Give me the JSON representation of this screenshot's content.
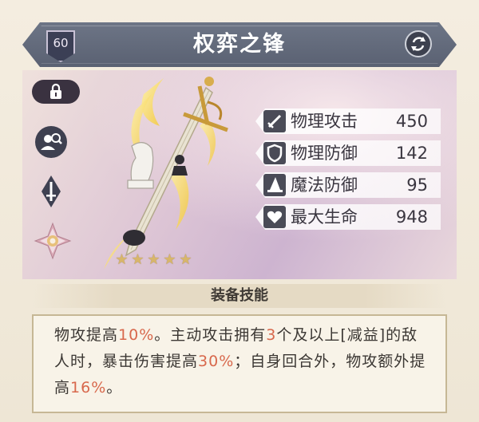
{
  "header": {
    "level": "60",
    "title": "权弈之锋"
  },
  "stats": [
    {
      "icon": "sword-icon",
      "label": "物理攻击",
      "value": "450"
    },
    {
      "icon": "shield-icon",
      "label": "物理防御",
      "value": "142"
    },
    {
      "icon": "wizard-hat-icon",
      "label": "魔法防御",
      "value": "95"
    },
    {
      "icon": "heart-icon",
      "label": "最大生命",
      "value": "948"
    }
  ],
  "rating": {
    "stars": 5,
    "max": 5
  },
  "skill": {
    "title": "装备技能",
    "segments": [
      {
        "text": "物攻提高",
        "highlight": false
      },
      {
        "text": "10%",
        "highlight": true
      },
      {
        "text": "。主动攻击拥有",
        "highlight": false
      },
      {
        "text": "3",
        "highlight": true
      },
      {
        "text": "个及以上[减益]的敌人时，暴击伤害提高",
        "highlight": false
      },
      {
        "text": "30%",
        "highlight": true
      },
      {
        "text": "；自身回合外，物攻额外提高",
        "highlight": false
      },
      {
        "text": "16%",
        "highlight": true
      },
      {
        "text": "。",
        "highlight": false
      }
    ]
  },
  "colors": {
    "header_bg": "#5f6676",
    "highlight": "#d8684c",
    "text": "#3b3733",
    "star": "#d8b66a"
  }
}
